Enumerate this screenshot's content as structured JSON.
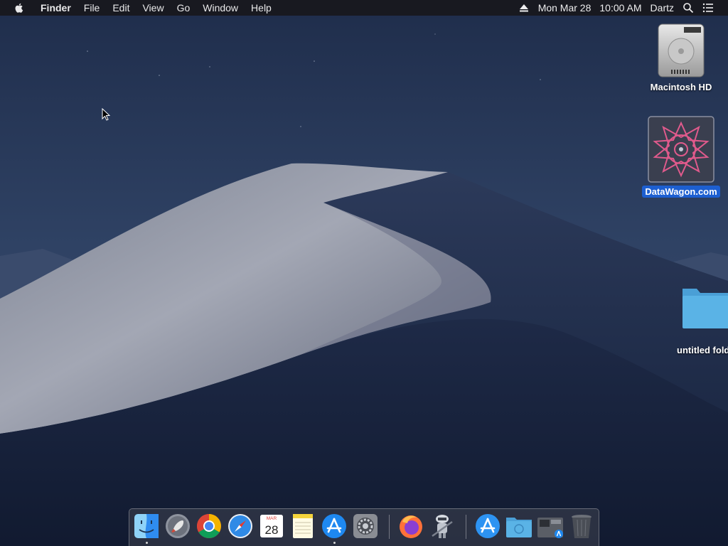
{
  "menubar": {
    "app_name": "Finder",
    "menus": [
      "File",
      "Edit",
      "View",
      "Go",
      "Window",
      "Help"
    ],
    "date": "Mon Mar 28",
    "time": "10:00 AM",
    "user": "Dartz",
    "icons": [
      "apple-icon",
      "eject-icon",
      "spotlight-search-icon",
      "notification-center-icon"
    ]
  },
  "desktop": {
    "icons": [
      {
        "label": "Macintosh HD",
        "icon": "hard-drive-icon",
        "selected": false
      },
      {
        "label": "DataWagon.com",
        "icon": "mandala-image-icon",
        "selected": true
      },
      {
        "label": "untitled folder",
        "icon": "folder-icon",
        "selected": false
      }
    ]
  },
  "dock": {
    "apps": [
      {
        "name": "Finder",
        "icon": "finder-icon",
        "running": true
      },
      {
        "name": "Launchpad",
        "icon": "launchpad-rocket-icon",
        "running": false
      },
      {
        "name": "Google Chrome",
        "icon": "chrome-icon",
        "running": false
      },
      {
        "name": "Safari",
        "icon": "safari-compass-icon",
        "running": false
      },
      {
        "name": "Calendar",
        "icon": "calendar-icon",
        "running": false,
        "month": "MAR",
        "day": "28"
      },
      {
        "name": "Notes",
        "icon": "notes-icon",
        "running": false
      },
      {
        "name": "App Store",
        "icon": "app-store-icon",
        "running": true
      },
      {
        "name": "System Preferences",
        "icon": "gear-icon",
        "running": false
      },
      {
        "name": "Firefox",
        "icon": "firefox-icon",
        "running": false
      },
      {
        "name": "Automator",
        "icon": "automator-robot-icon",
        "running": false
      },
      {
        "name": "App Store",
        "icon": "app-store-icon",
        "running": false
      },
      {
        "name": "Applications",
        "icon": "applications-folder-icon",
        "running": false
      },
      {
        "name": "Downloads",
        "icon": "downloads-stack-icon",
        "running": false
      },
      {
        "name": "Trash",
        "icon": "trash-icon",
        "running": false
      }
    ]
  },
  "colors": {
    "selection": "#1d5fd1",
    "folder": "#5ab3e6",
    "sky_top": "#1f2d4b",
    "dune_light": "#a3a7b4"
  }
}
